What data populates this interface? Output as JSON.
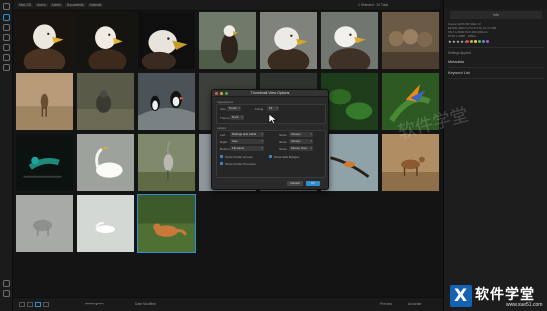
{
  "topbar": {
    "breadcrumb": [
      "Mac OS",
      "Users",
      "Admin",
      "Documents",
      "Animals"
    ],
    "selection_info": "1 Selected · 20 Total"
  },
  "status": {
    "sort_label": "Date Modified",
    "preview_label": "Preview",
    "mode_label": "Accurate"
  },
  "right_panel": {
    "header": "Info",
    "info_lines": [
      "Canon EOS 5D Mark IV",
      "EF100-400mm f/4.5-5.6L IS II USM",
      "f/6.3  1/1000  ISO 400  400mm",
      "6720 x 4480  ·  JPEG"
    ],
    "stars": "★★★★★",
    "sections": [
      "Settings Applied",
      "Metadata",
      "Keyword List"
    ],
    "label_colors": [
      "#d24c4c",
      "#e0a53a",
      "#dcd24b",
      "#5ab157",
      "#4b8fd1",
      "#9b5fd1"
    ]
  },
  "dialog": {
    "title": "Thumbnail View Options",
    "appearance_group": "Appearance",
    "size_label": "Size",
    "size_value": "Small",
    "fixing_label": "Fixing",
    "fixing_value": "Fit",
    "theme_label": "Theme",
    "theme_value": "Dark",
    "labels_group": "Labels",
    "left_label": "Left",
    "left_value": "Ratings and Label",
    "right_label": "Right",
    "right_value": "Like",
    "bottom_label": "Bottom",
    "bottom_value": "Filename",
    "show_label": "Show",
    "show_value_1": "Always",
    "show_value_2": "Always",
    "show_value_3": "Mouse Over",
    "check_1": "Show Folder Arrows",
    "check_2": "Show Edit Badges",
    "check_3": "Show Folder Previews",
    "cancel": "Cancel",
    "ok": "OK"
  },
  "brand": {
    "badge": "X",
    "name": "软件学堂",
    "url": "www.xue51.com"
  },
  "watermark": "软件学堂"
}
